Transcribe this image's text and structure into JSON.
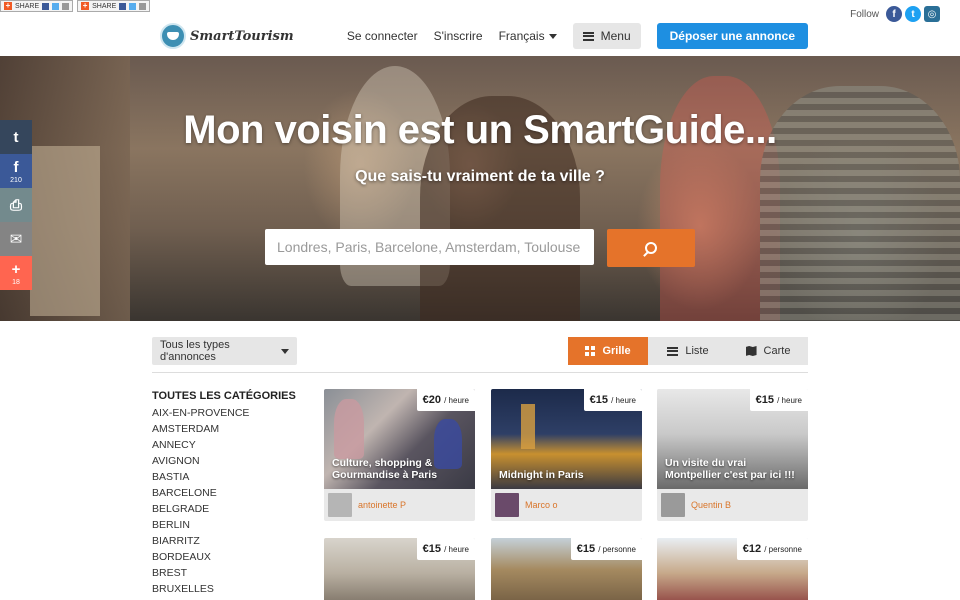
{
  "share_bar": {
    "label1": "SHARE",
    "label2": "SHARE"
  },
  "follow": {
    "label": "Follow",
    "icons": [
      "facebook-icon",
      "twitter-icon",
      "instagram-icon"
    ],
    "facebook": "f",
    "twitter": "t",
    "instagram": "◎"
  },
  "header": {
    "brand": "SmartTourism",
    "login": "Se connecter",
    "signup": "S'inscrire",
    "language": "Français",
    "menu": "Menu",
    "post": "Déposer une annonce"
  },
  "hero": {
    "title": "Mon voisin est un SmartGuide...",
    "subtitle": "Que sais-tu vraiment de ta ville ?",
    "search_placeholder": "Londres, Paris, Barcelone, Amsterdam, Toulouse"
  },
  "social_rail": [
    {
      "icon": "tumblr-icon",
      "glyph": "t",
      "count": "",
      "color": "#35465c"
    },
    {
      "icon": "facebook-icon",
      "glyph": "f",
      "count": "210",
      "color": "#3b5998"
    },
    {
      "icon": "print-icon",
      "glyph": "⎙",
      "count": "",
      "color": "#738a8d"
    },
    {
      "icon": "email-icon",
      "glyph": "✉",
      "count": "",
      "color": "#848484"
    },
    {
      "icon": "share-plus-icon",
      "glyph": "+",
      "count": "18",
      "color": "#ff6550"
    }
  ],
  "filters": {
    "types": "Tous les types d'annonces",
    "view_grid": "Grille",
    "view_list": "Liste",
    "view_map": "Carte"
  },
  "categories": {
    "heading": "TOUTES LES CATÉGORIES",
    "items": [
      "AIX-EN-PROVENCE",
      "AMSTERDAM",
      "ANNECY",
      "AVIGNON",
      "BASTIA",
      "BARCELONE",
      "BELGRADE",
      "BERLIN",
      "BIARRITZ",
      "BORDEAUX",
      "BREST",
      "BRUXELLES"
    ]
  },
  "listings": [
    {
      "price": "€20",
      "unit": "/ heure",
      "title": "Culture, shopping & Gourmandise à Paris",
      "author": "antoinette P"
    },
    {
      "price": "€15",
      "unit": "/ heure",
      "title": "Midnight in Paris",
      "author": "Marco o"
    },
    {
      "price": "€15",
      "unit": "/ heure",
      "title": "Un visite du vrai Montpellier c'est par ici !!!",
      "author": "Quentin B"
    },
    {
      "price": "€15",
      "unit": "/ heure"
    },
    {
      "price": "€15",
      "unit": "/ personne"
    },
    {
      "price": "€12",
      "unit": "/ personne"
    }
  ],
  "colors": {
    "accent": "#e5732a",
    "primary": "#1e8fe1",
    "author": "#d9752a"
  }
}
